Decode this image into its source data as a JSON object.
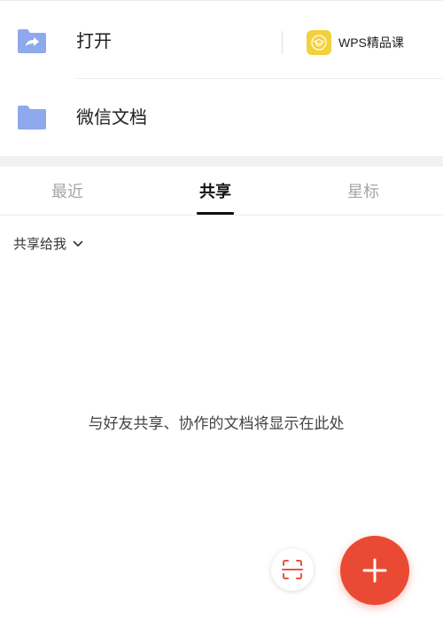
{
  "rows": {
    "open_label": "打开",
    "wechat_label": "微信文档"
  },
  "wps_course": {
    "label": "WPS精品课"
  },
  "tabs": [
    {
      "label": "最近"
    },
    {
      "label": "共享"
    },
    {
      "label": "星标"
    }
  ],
  "active_tab": "共享",
  "filter": {
    "label": "共享给我"
  },
  "empty_state": {
    "message": "与好友共享、协作的文档将显示在此处"
  },
  "colors": {
    "folder": "#8fa9ee",
    "fab": "#ea4a33",
    "wps_badge": "#f3d03e",
    "scan_accent": "#e8553f"
  },
  "icons": {
    "open": "folder-share-icon",
    "wechat": "folder-icon",
    "wps": "graduation-cap-icon",
    "filter": "chevron-down-icon",
    "scan": "scan-icon",
    "fab": "plus-icon"
  }
}
